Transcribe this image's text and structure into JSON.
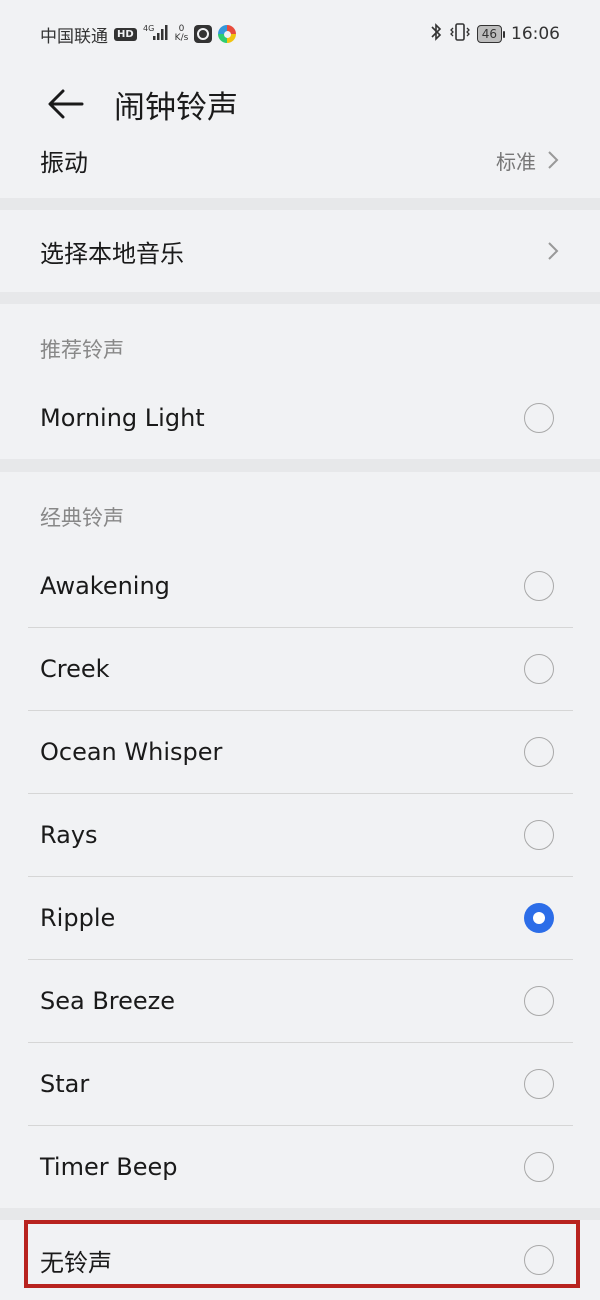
{
  "status_bar": {
    "carrier": "中国联通",
    "hd_badge": "HD",
    "net_type": "4G",
    "speed_value": "0",
    "speed_unit": "K/s",
    "battery": "46",
    "time": "16:06",
    "icons": [
      "signal-icon",
      "camera-app-icon",
      "colorful-app-icon",
      "bluetooth-icon",
      "vibrate-icon",
      "battery-icon"
    ]
  },
  "header": {
    "title": "闹钟铃声",
    "back_icon": "back-arrow-icon"
  },
  "vibration": {
    "label": "振动",
    "value": "标准"
  },
  "local_music": {
    "label": "选择本地音乐"
  },
  "recommended": {
    "section_title": "推荐铃声",
    "items": [
      {
        "label": "Morning Light",
        "selected": false
      }
    ]
  },
  "classic": {
    "section_title": "经典铃声",
    "items": [
      {
        "label": "Awakening",
        "selected": false
      },
      {
        "label": "Creek",
        "selected": false
      },
      {
        "label": "Ocean Whisper",
        "selected": false
      },
      {
        "label": "Rays",
        "selected": false
      },
      {
        "label": "Ripple",
        "selected": true
      },
      {
        "label": "Sea Breeze",
        "selected": false
      },
      {
        "label": "Star",
        "selected": false
      },
      {
        "label": "Timer Beep",
        "selected": false
      }
    ]
  },
  "none_option": {
    "label": "无铃声",
    "selected": false
  },
  "colors": {
    "accent": "#2c6de8",
    "highlight_border": "#b8231f",
    "background": "#f1f2f4"
  }
}
